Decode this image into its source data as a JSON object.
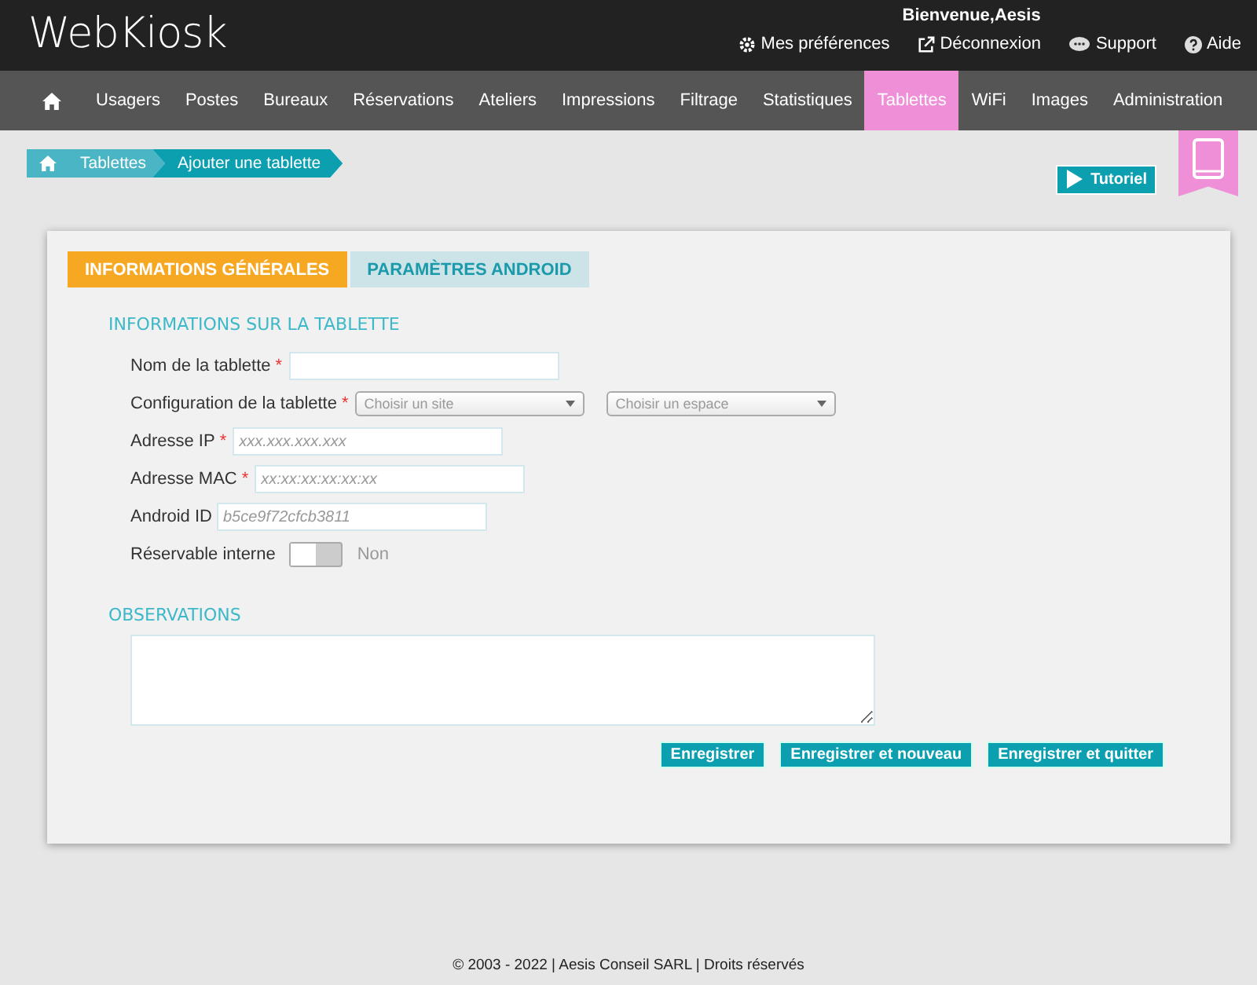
{
  "header": {
    "logo": "WebKiosk",
    "welcome": "Bienvenue,Aesis",
    "links": [
      {
        "kind": "gear",
        "label": "Mes préférences"
      },
      {
        "kind": "external",
        "label": "Déconnexion"
      },
      {
        "kind": "chat",
        "label": "Support"
      },
      {
        "kind": "help",
        "label": "Aide"
      }
    ]
  },
  "nav": [
    {
      "kind": "home",
      "selected": false
    },
    {
      "label": "Usagers",
      "selected": false
    },
    {
      "label": "Postes",
      "selected": false
    },
    {
      "label": "Bureaux",
      "selected": false
    },
    {
      "label": "Réservations",
      "selected": false
    },
    {
      "label": "Ateliers",
      "selected": false
    },
    {
      "label": "Impressions",
      "selected": false
    },
    {
      "label": "Filtrage",
      "selected": false
    },
    {
      "label": "Statistiques",
      "selected": false
    },
    {
      "label": "Tablettes",
      "selected": true
    },
    {
      "label": "WiFi",
      "selected": false
    },
    {
      "label": "Images",
      "selected": false
    },
    {
      "label": "Administration",
      "selected": false
    }
  ],
  "breadcrumb": [
    "Tablettes",
    "Ajouter une tablette"
  ],
  "tutorial_button": "Tutoriel",
  "tabs": [
    {
      "label": "INFORMATIONS GÉNÉRALES",
      "selected": true
    },
    {
      "label": "PARAMÈTRES ANDROID",
      "selected": false
    }
  ],
  "section_title": "INFORMATIONS SUR LA TABLETTE",
  "fields": [
    {
      "kind": "text",
      "label": "Nom de la tablette",
      "required_mark": "*"
    },
    {
      "kind": "selects",
      "label": "Configuration de la tablette",
      "required_mark": "*",
      "options": [
        "Choisir un site",
        "Choisir un espace"
      ]
    },
    {
      "kind": "text",
      "label": "Adresse IP",
      "required_mark": "*",
      "placeholder": "xxx.xxx.xxx.xxx"
    },
    {
      "kind": "text",
      "label": "Adresse MAC",
      "required_mark": "*",
      "placeholder": "xx:xx:xx:xx:xx:xx"
    },
    {
      "kind": "text",
      "label": "Android ID",
      "placeholder": "b5ce9f72cfcb3811"
    },
    {
      "kind": "toggle",
      "label": "Réservable interne",
      "on": false,
      "state_text": "Non"
    }
  ],
  "observations_title": "OBSERVATIONS",
  "buttons": [
    "Enregistrer",
    "Enregistrer et nouveau",
    "Enregistrer et quitter"
  ],
  "footer": "© 2003 - 2022 | Aesis Conseil SARL | Droits réservés"
}
